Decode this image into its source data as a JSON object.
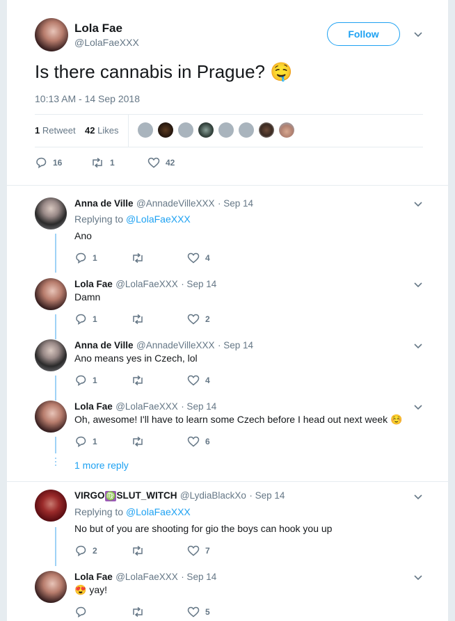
{
  "main_tweet": {
    "name": "Lola Fae",
    "handle": "@LolaFaeXXX",
    "follow_label": "Follow",
    "text": "Is there cannabis in Prague?",
    "emoji": "🤤",
    "timestamp": "10:13 AM - 14 Sep 2018",
    "retweets_count": "1",
    "retweets_label": "Retweet",
    "likes_count": "42",
    "likes_label": "Likes",
    "actions": {
      "replies": "16",
      "retweets": "1",
      "likes": "42"
    }
  },
  "replies": [
    {
      "name": "Anna de Ville",
      "handle": "@AnnadeVilleXXX",
      "date": "· Sep 14",
      "replying_prefix": "Replying to",
      "replying_to": "@LolaFaeXXX",
      "text": "Ano",
      "replies": "1",
      "likes": "4"
    },
    {
      "name": "Lola Fae",
      "handle": "@LolaFaeXXX",
      "date": "· Sep 14",
      "text": "Damn",
      "replies": "1",
      "likes": "2"
    },
    {
      "name": "Anna de Ville",
      "handle": "@AnnadeVilleXXX",
      "date": "· Sep 14",
      "text": "Ano means yes in Czech, lol",
      "replies": "1",
      "likes": "4"
    },
    {
      "name": "Lola Fae",
      "handle": "@LolaFaeXXX",
      "date": "· Sep 14",
      "text": "Oh, awesome! I'll have to learn some Czech before I head out next week",
      "emoji": "☺️",
      "replies": "1",
      "likes": "6"
    },
    {
      "name_prefix": "VIRGO",
      "name_symbol": "♍",
      "name_suffix": "SLUT_WITCH",
      "handle": "@LydiaBlackXo",
      "date": "· Sep 14",
      "replying_prefix": "Replying to",
      "replying_to": "@LolaFaeXXX",
      "text": "No but of you are shooting for gio the boys can hook you up",
      "replies": "2",
      "likes": "7"
    },
    {
      "name": "Lola Fae",
      "handle": "@LolaFaeXXX",
      "date": "· Sep 14",
      "emoji": "😍",
      "text": "yay!",
      "replies": "",
      "likes": "5"
    }
  ],
  "more_replies_label": "1 more reply",
  "colors": {
    "accent": "#1da1f2",
    "thread_line": "#9fd2f6",
    "muted": "#657786",
    "divider": "#e6ecf0"
  }
}
